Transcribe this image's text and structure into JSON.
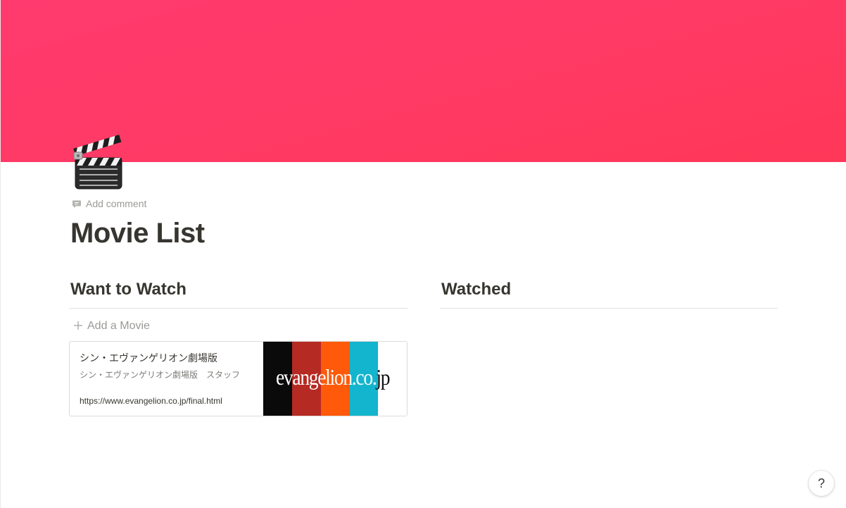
{
  "cover": {
    "color": "#ff3a66"
  },
  "page": {
    "icon": "clapper-board-icon",
    "add_comment": "Add comment",
    "title": "Movie List"
  },
  "board": {
    "columns": [
      {
        "heading": "Want to Watch",
        "add_label": "Add a Movie",
        "cards": [
          {
            "title": "シン・エヴァンゲリオン劇場版",
            "description": "シン・エヴァンゲリオン劇場版　スタッフ",
            "url": "https://www.evangelion.co.jp/final.html",
            "thumbnail": {
              "logo_text_light": "evangelion.co.",
              "logo_text_dark": "jp",
              "stripes": [
                "#0a0a0a",
                "#b52a23",
                "#ff5a0a",
                "#12b5cd",
                "#ffffff"
              ]
            }
          }
        ]
      },
      {
        "heading": "Watched",
        "cards": []
      }
    ]
  },
  "help": {
    "label": "?"
  }
}
